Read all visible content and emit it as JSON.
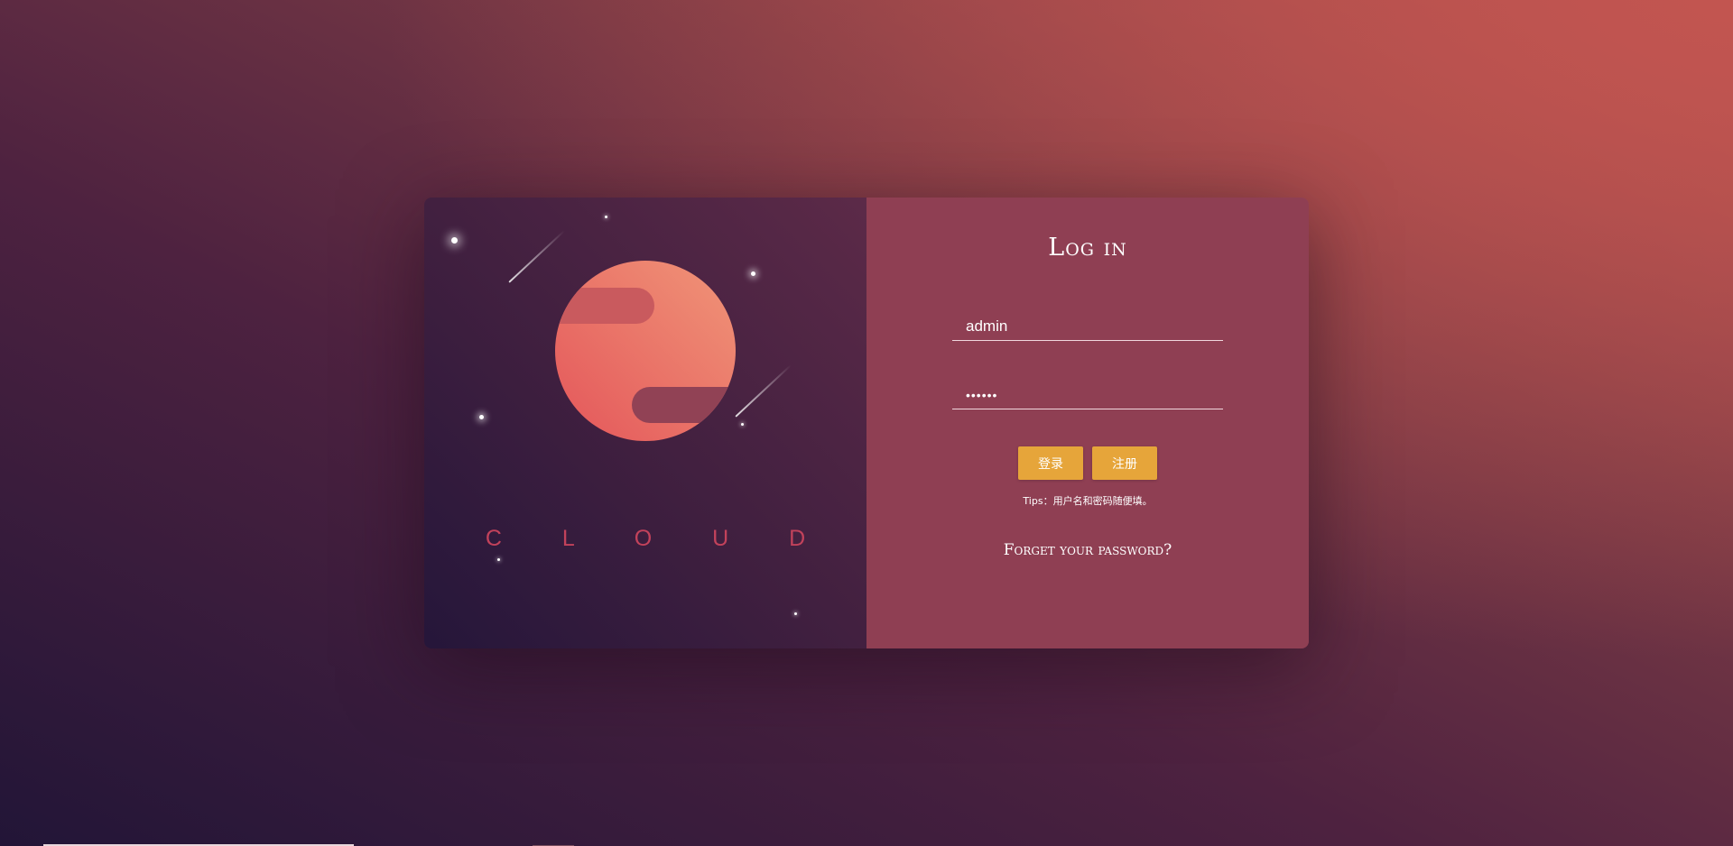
{
  "brand": {
    "text": "C L O U D"
  },
  "login_form": {
    "title": "Log in",
    "username_value": "admin",
    "password_value": "••••••",
    "login_button": "登录",
    "register_button": "注册",
    "tips": "Tips：用户名和密码随便填。",
    "forget_link": "Forget your password?"
  },
  "colors": {
    "accent_button": "#e6a53a",
    "brand_text": "#c2425b",
    "form_panel": "#8f3f53",
    "planet": "#e8675f"
  },
  "icons": {
    "planet": "planet-illustration",
    "stars": "star-icons",
    "meteors": "meteor-icons"
  }
}
